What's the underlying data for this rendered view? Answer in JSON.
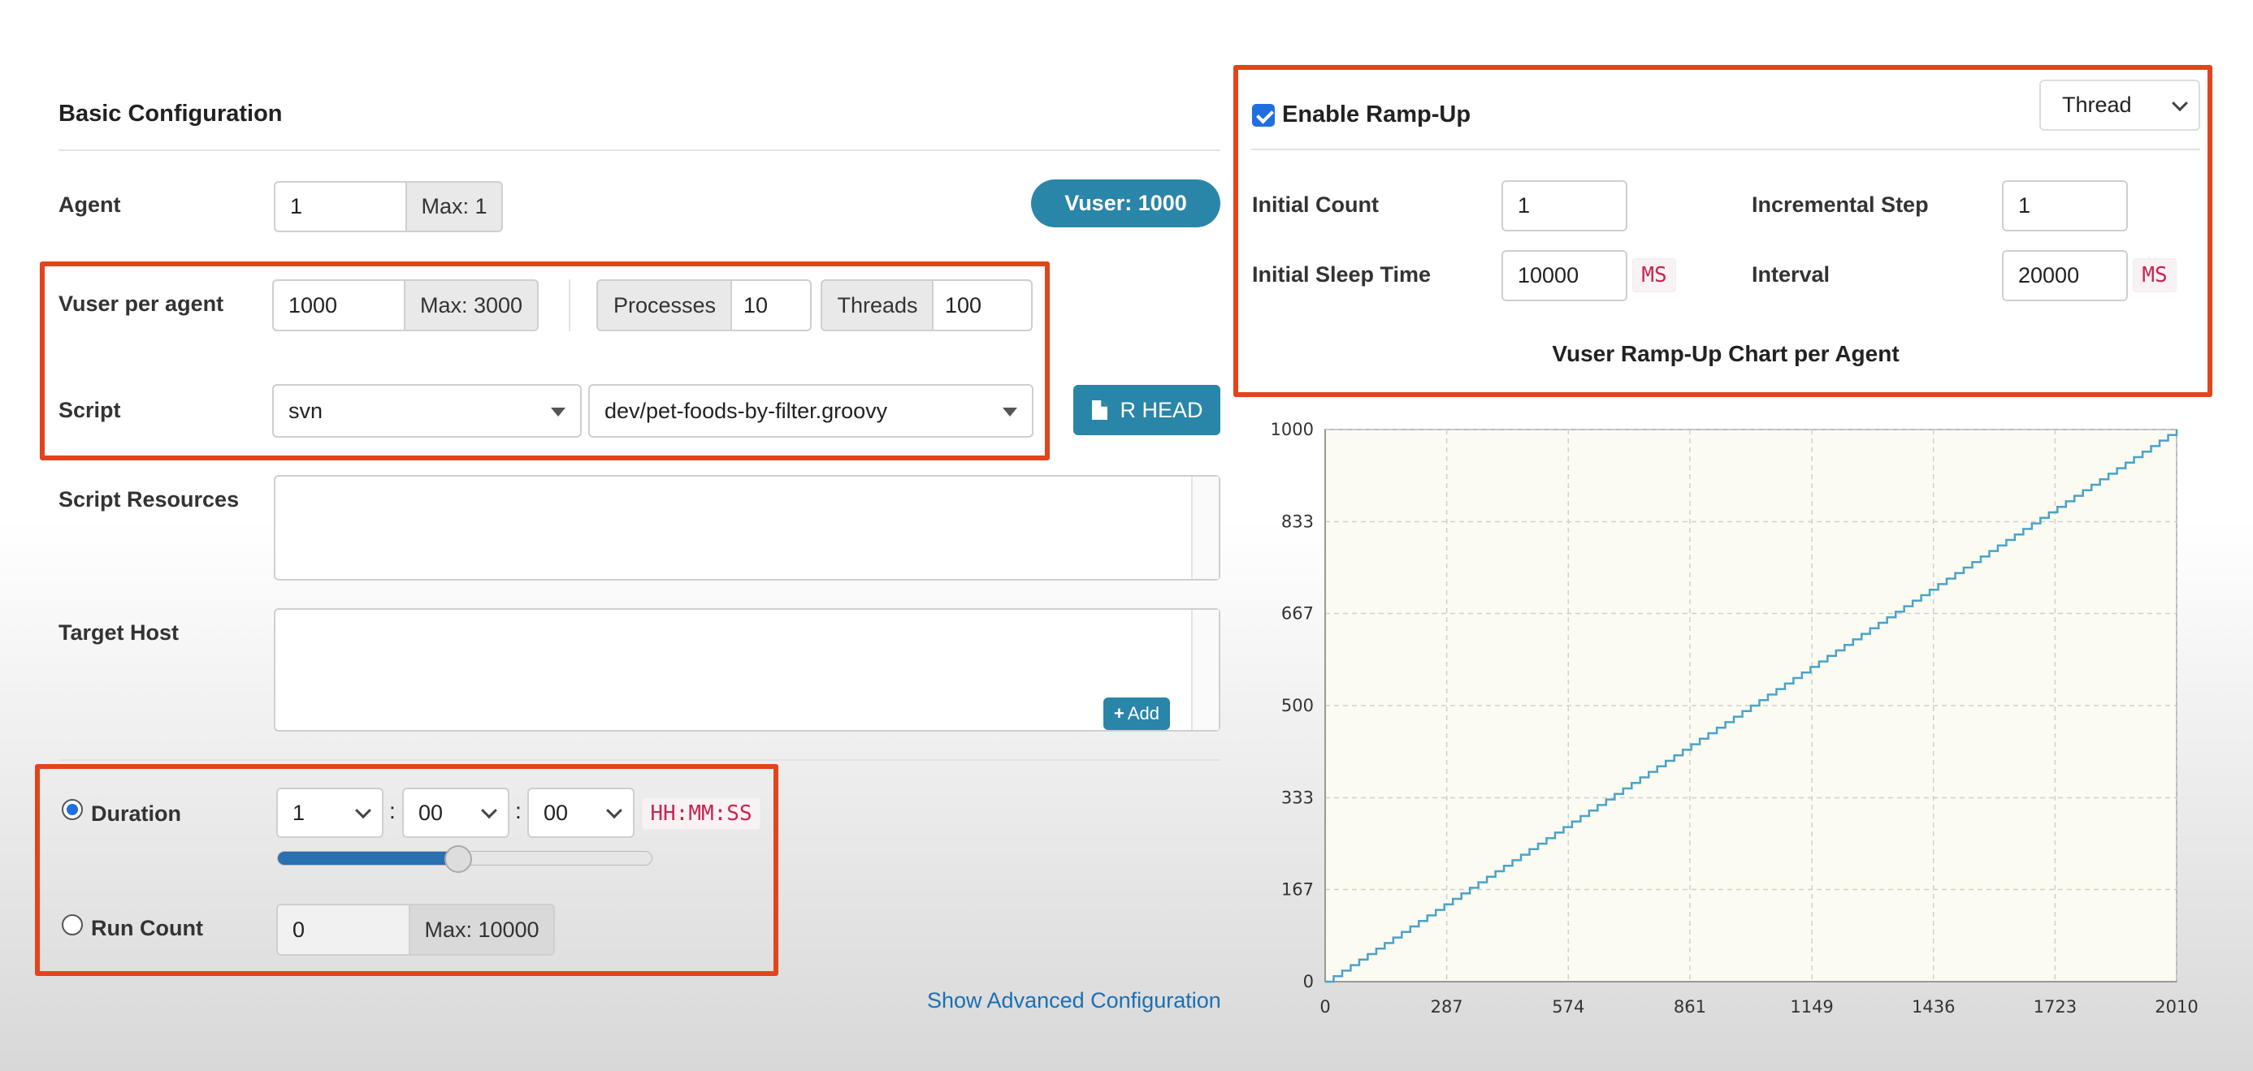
{
  "basic": {
    "title": "Basic Configuration",
    "agent": {
      "label": "Agent",
      "value": "1",
      "max": "Max: 1"
    },
    "vuser_badge": "Vuser: 1000",
    "vuser_per_agent": {
      "label": "Vuser per agent",
      "value": "1000",
      "max": "Max: 3000",
      "processes_label": "Processes",
      "processes_value": "10",
      "threads_label": "Threads",
      "threads_value": "100"
    },
    "script": {
      "label": "Script",
      "repo": "svn",
      "file": "dev/pet-foods-by-filter.groovy",
      "head_button": "R HEAD"
    },
    "script_resources": {
      "label": "Script Resources"
    },
    "target_host": {
      "label": "Target Host",
      "add_button": "Add"
    },
    "duration": {
      "label": "Duration",
      "hours": "1",
      "minutes": "00",
      "seconds": "00",
      "format": "HH:MM:SS",
      "sep": ":",
      "slider_fraction": 0.48
    },
    "run_count": {
      "label": "Run Count",
      "value": "0",
      "max": "Max: 10000"
    },
    "advanced_link": "Show Advanced Configuration"
  },
  "rampup": {
    "enable_label": "Enable Ramp-Up",
    "enabled": true,
    "type_select": "Thread",
    "initial_count": {
      "label": "Initial Count",
      "value": "1"
    },
    "incremental_step": {
      "label": "Incremental Step",
      "value": "1"
    },
    "initial_sleep_time": {
      "label": "Initial Sleep Time",
      "value": "10000",
      "unit": "MS"
    },
    "interval": {
      "label": "Interval",
      "value": "20000",
      "unit": "MS"
    },
    "chart_title": "Vuser Ramp-Up Chart per Agent"
  },
  "chart_data": {
    "type": "line",
    "title": "Vuser Ramp-Up Chart per Agent",
    "xlabel": "",
    "ylabel": "",
    "xlim": [
      0,
      2010
    ],
    "ylim": [
      0,
      1000
    ],
    "x_ticks": [
      "0",
      "287",
      "574",
      "861",
      "1149",
      "1436",
      "1723",
      "2010"
    ],
    "y_ticks": [
      "0",
      "167",
      "333",
      "500",
      "667",
      "833",
      "1000"
    ],
    "grid": true,
    "series": [
      {
        "x": [
          0,
          2010
        ],
        "y": [
          0,
          1000
        ],
        "step": true,
        "steps": 100
      }
    ],
    "line_color": "#4aa3c8",
    "background": "#fbfbf1"
  },
  "colors": {
    "accent": "#2a86a8",
    "highlight": "#e2441c",
    "checkbox": "#1f6fe0",
    "link": "#1a6fb5"
  }
}
